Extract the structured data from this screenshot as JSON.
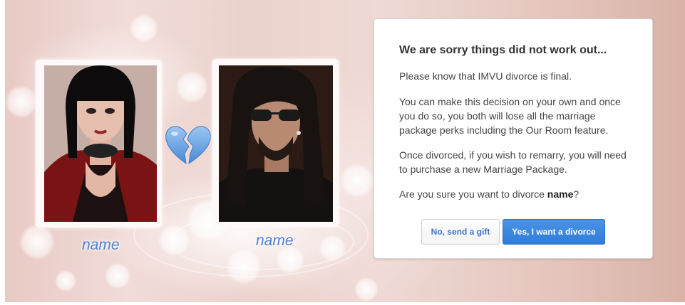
{
  "partners": {
    "left_name": "name",
    "right_name": "name"
  },
  "icons": {
    "broken_heart": "broken-heart-icon"
  },
  "dialog": {
    "title": "We are sorry things did not work out...",
    "paragraph_1": "Please know that IMVU divorce is final.",
    "paragraph_2": "You can make this decision on your own and once you do so, you both will lose all the marriage package perks including the Our Room feature.",
    "paragraph_3": "Once divorced, if you wish to remarry, you will need to purchase a new Marriage Package.",
    "question_prefix": "Are you sure you want to divorce ",
    "question_name": "name",
    "question_suffix": "?",
    "no_button_label": "No, send a gift",
    "yes_button_label": "Yes, I want a divorce"
  },
  "colors": {
    "primary_button": "#3584dd",
    "name_label": "#4f7fd2",
    "heart": "#6aa6e8"
  }
}
